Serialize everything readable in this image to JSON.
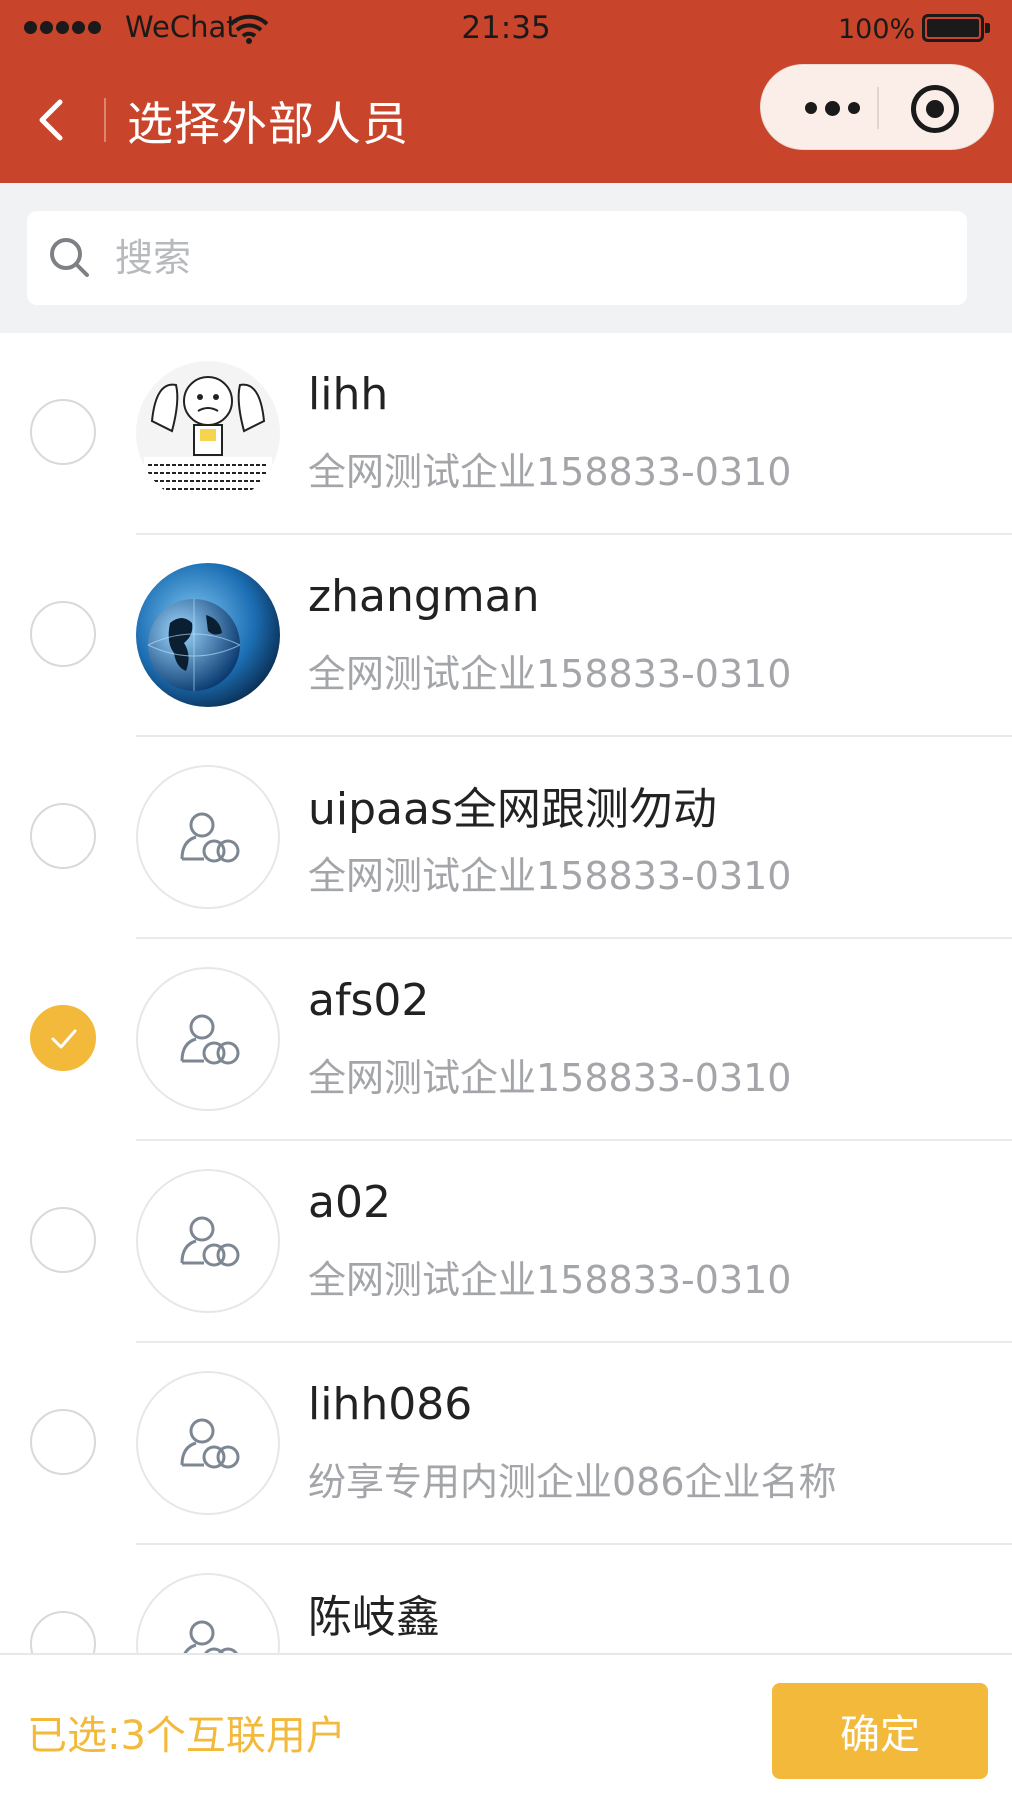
{
  "status_bar": {
    "carrier": "WeChat",
    "time": "21:35",
    "battery": "100%"
  },
  "nav": {
    "title": "选择外部人员"
  },
  "search": {
    "placeholder": "搜索"
  },
  "contacts": [
    {
      "name": "lihh",
      "org": "全网测试企业158833-0310",
      "checked": false,
      "avatar": "cartoon-photo"
    },
    {
      "name": "zhangman",
      "org": "全网测试企业158833-0310",
      "checked": false,
      "avatar": "globe-photo"
    },
    {
      "name": "uipaas全网跟测勿动",
      "org": "全网测试企业158833-0310",
      "checked": false,
      "avatar": "default-user-icon"
    },
    {
      "name": "afs02",
      "org": "全网测试企业158833-0310",
      "checked": true,
      "avatar": "default-user-icon"
    },
    {
      "name": "a02",
      "org": "全网测试企业158833-0310",
      "checked": false,
      "avatar": "default-user-icon"
    },
    {
      "name": "lihh086",
      "org": "纷享专用内测企业086企业名称",
      "checked": false,
      "avatar": "default-user-icon"
    },
    {
      "name": "陈岐鑫",
      "org": "",
      "checked": false,
      "avatar": "default-user-icon"
    }
  ],
  "footer": {
    "selected_text": "已选:3个互联用户",
    "confirm_label": "确定"
  },
  "colors": {
    "nav_bg": "#c8442a",
    "accent": "#f3b93a"
  }
}
